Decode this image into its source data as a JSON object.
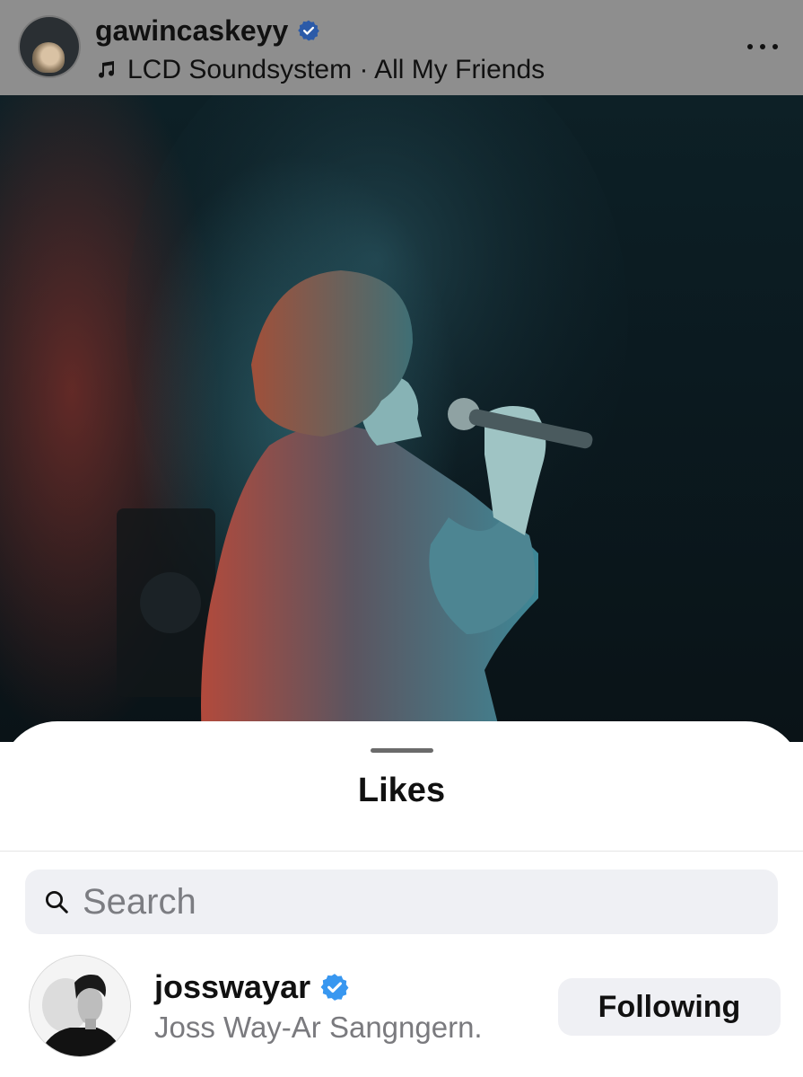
{
  "post": {
    "username": "gawincaskeyy",
    "audio": "LCD Soundsystem · All My Friends"
  },
  "likes_sheet": {
    "title": "Likes",
    "search": {
      "placeholder": "Search",
      "value": ""
    },
    "users": [
      {
        "username": "josswayar",
        "full_name": "Joss Way-Ar Sangngern.",
        "verified": true,
        "button_label": "Following"
      }
    ]
  },
  "colors": {
    "verified_blue": "#3897f0",
    "search_bg": "#eff0f4",
    "header_dim": "#8e8e8e"
  }
}
